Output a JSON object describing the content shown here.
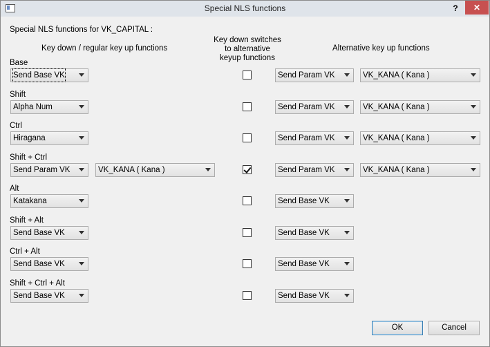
{
  "window": {
    "title": "Special NLS functions",
    "help_label": "?",
    "close_label": "✕"
  },
  "header": {
    "heading": "Special NLS functions for VK_CAPITAL :",
    "col_keydown": "Key down / regular key up functions",
    "col_switch_line1": "Key down switches",
    "col_switch_line2": "to alternative",
    "col_switch_line3": "keyup functions",
    "col_alt": "Alternative key up functions"
  },
  "rows": [
    {
      "label": "Base",
      "func": "Send Base VK",
      "param": "",
      "checked": false,
      "alt_func": "Send Param VK",
      "alt_param": "VK_KANA ( Kana )"
    },
    {
      "label": "Shift",
      "func": "Alpha Num",
      "param": "",
      "checked": false,
      "alt_func": "Send Param VK",
      "alt_param": "VK_KANA ( Kana )"
    },
    {
      "label": "Ctrl",
      "func": "Hiragana",
      "param": "",
      "checked": false,
      "alt_func": "Send Param VK",
      "alt_param": "VK_KANA ( Kana )"
    },
    {
      "label": "Shift + Ctrl",
      "func": "Send Param VK",
      "param": "VK_KANA ( Kana )",
      "checked": true,
      "alt_func": "Send Param VK",
      "alt_param": "VK_KANA ( Kana )"
    },
    {
      "label": "Alt",
      "func": "Katakana",
      "param": "",
      "checked": false,
      "alt_func": "Send Base VK",
      "alt_param": ""
    },
    {
      "label": "Shift + Alt",
      "func": "Send Base VK",
      "param": "",
      "checked": false,
      "alt_func": "Send Base VK",
      "alt_param": ""
    },
    {
      "label": "Ctrl + Alt",
      "func": "Send Base VK",
      "param": "",
      "checked": false,
      "alt_func": "Send Base VK",
      "alt_param": ""
    },
    {
      "label": "Shift + Ctrl + Alt",
      "func": "Send Base VK",
      "param": "",
      "checked": false,
      "alt_func": "Send Base VK",
      "alt_param": ""
    }
  ],
  "buttons": {
    "ok": "OK",
    "cancel": "Cancel"
  }
}
